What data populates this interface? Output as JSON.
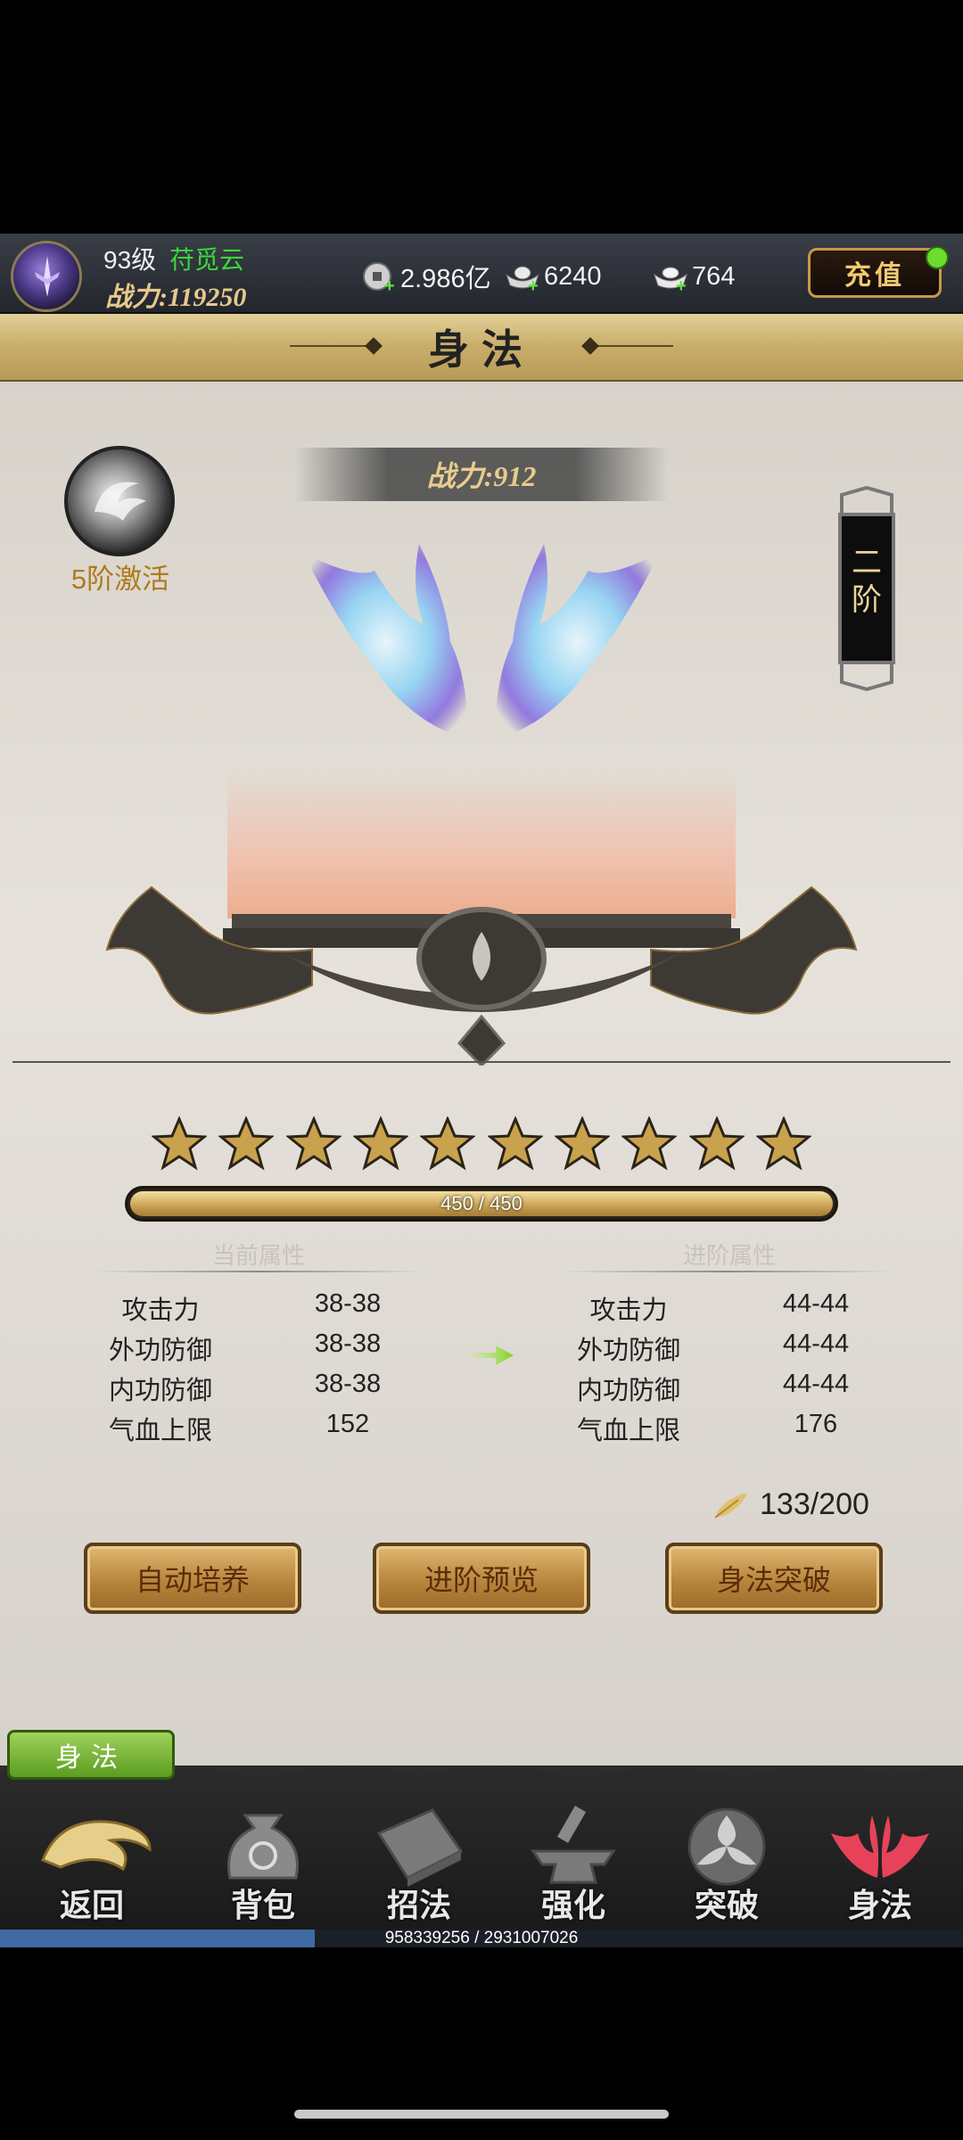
{
  "player": {
    "level": "93级",
    "name": "苻觅云",
    "power": "战力:119250"
  },
  "currencies": [
    {
      "icon": "copper-coin-icon",
      "value": "2.986亿"
    },
    {
      "icon": "silver-ingot-icon",
      "value": "6240"
    },
    {
      "icon": "gold-ingot-icon",
      "value": "764"
    }
  ],
  "recharge_label": "充值",
  "page_title": "身法",
  "skill": {
    "icon": "spiral-wind-icon",
    "activation_label": "5阶激活",
    "power": "战力:912",
    "tier_label": "二阶"
  },
  "stars": {
    "filled": 10,
    "total": 10
  },
  "progress": {
    "text": "450 / 450",
    "fraction": 1.0
  },
  "attributes": {
    "current_header": "当前属性",
    "next_header": "进阶属性",
    "current": [
      {
        "name": "攻击力",
        "value": "38-38"
      },
      {
        "name": "外功防御",
        "value": "38-38"
      },
      {
        "name": "内功防御",
        "value": "38-38"
      },
      {
        "name": "气血上限",
        "value": "152"
      }
    ],
    "next": [
      {
        "name": "攻击力",
        "value": "44-44"
      },
      {
        "name": "外功防御",
        "value": "44-44"
      },
      {
        "name": "内功防御",
        "value": "44-44"
      },
      {
        "name": "气血上限",
        "value": "176"
      }
    ]
  },
  "material": {
    "icon": "feather-icon",
    "count": "133/200"
  },
  "buttons": {
    "auto": "自动培养",
    "preview": "进阶预览",
    "breakthrough": "身法突破"
  },
  "section_tag": "身法",
  "nav": [
    {
      "label": "返回",
      "icon": "dragon-return-icon"
    },
    {
      "label": "背包",
      "icon": "bag-icon"
    },
    {
      "label": "招法",
      "icon": "book-icon"
    },
    {
      "label": "强化",
      "icon": "anvil-icon"
    },
    {
      "label": "突破",
      "icon": "triskelion-icon"
    },
    {
      "label": "身法",
      "icon": "red-wings-icon"
    }
  ],
  "exp": {
    "text": "958339256 / 2931007026",
    "fraction": 0.327
  },
  "colors": {
    "name_green": "#39d93b",
    "gold": "#e6c98b",
    "button_brown": "#b8853c"
  }
}
